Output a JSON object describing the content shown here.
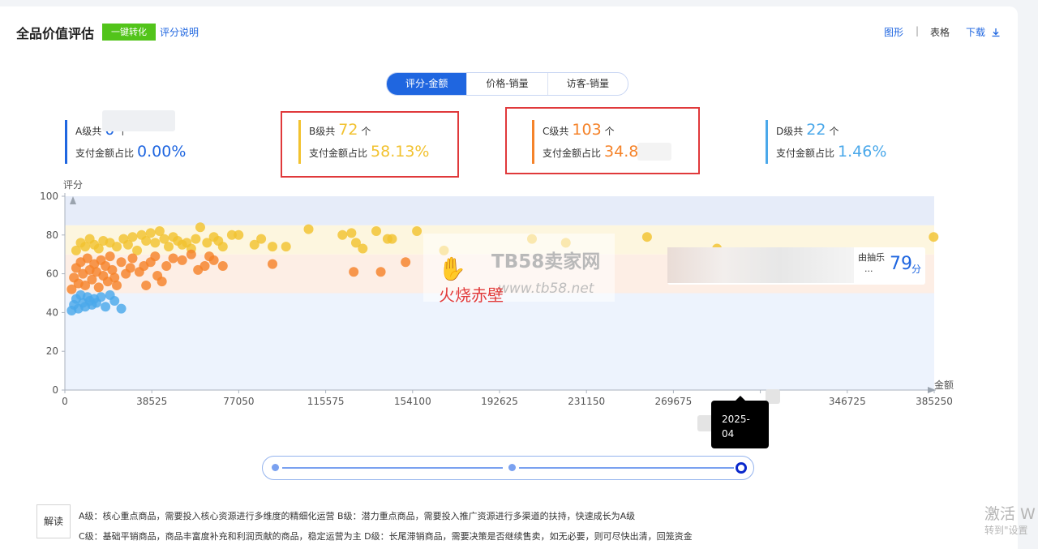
{
  "header": {
    "title": "全品价值评估",
    "convert_button": "一键转化",
    "score_link": "评分说明",
    "graph_link": "图形",
    "separator": "|",
    "table_link": "表格",
    "download_link": "下载"
  },
  "tabs": [
    {
      "label": "评分-金额",
      "active": true
    },
    {
      "label": "价格-销量",
      "active": false
    },
    {
      "label": "访客-销量",
      "active": false
    }
  ],
  "grades": [
    {
      "label": "A级共",
      "count": "0",
      "unit": "个",
      "ratio_label": "支付金额占比",
      "ratio": "0.00%",
      "color": "#1f66e0"
    },
    {
      "label": "B级共",
      "count": "72",
      "unit": "个",
      "ratio_label": "支付金额占比",
      "ratio": "58.13%",
      "color": "#f2c230"
    },
    {
      "label": "C级共",
      "count": "103",
      "unit": "个",
      "ratio_label": "支付金额占比",
      "ratio": "34.86%",
      "color": "#f5832a"
    },
    {
      "label": "D级共",
      "count": "22",
      "unit": "个",
      "ratio_label": "支付金额占比",
      "ratio": "1.46%",
      "color": "#4aa8ea"
    }
  ],
  "tooltip": {
    "name": "由抽乐",
    "ellipsis": "...",
    "score": "79",
    "unit": "分"
  },
  "watermark": {
    "logo": "✋",
    "line1": "TB58卖家网",
    "line2": "www.tb58.net",
    "red": "火烧赤壁"
  },
  "timeline": {
    "date": "2025-04"
  },
  "interpretation": {
    "button": "解读",
    "line1": "A级：核心重点商品，需要投入核心资源进行多维度的精细化运营   B级：潜力重点商品，需要投入推广资源进行多渠道的扶持，快速成长为A级",
    "line2": "C级：基础平销商品，商品丰富度补充和利润贡献的商品，稳定运营为主   D级：长尾滞销商品，需要决策是否继续售卖，如无必要，则可尽快出清，回笼资金"
  },
  "activation": {
    "line1": "激活 W",
    "line2": "转到\"设置"
  },
  "colors": {
    "A": "#1f66e0",
    "B": "#f2c230",
    "C": "#f5832a",
    "D": "#4aa8ea",
    "accent": "#1f66e0",
    "highlight": "#e0393b"
  },
  "chart_data": {
    "type": "scatter",
    "xlabel": "金额",
    "ylabel": "评分",
    "xlim": [
      0,
      385250
    ],
    "ylim": [
      0,
      100
    ],
    "x_ticks": [
      0,
      38525,
      77050,
      115575,
      154100,
      192625,
      231150,
      269675,
      308200,
      346725,
      385250
    ],
    "x_tick_labels": [
      "0",
      "38525",
      "77050",
      "115575",
      "154100",
      "192625",
      "231150",
      "269675",
      "",
      "346725",
      "385250"
    ],
    "y_ticks": [
      0,
      20,
      40,
      60,
      80,
      100
    ],
    "bands": [
      {
        "grade": "A",
        "from": 85,
        "to": 100,
        "color": "#e6ecf9"
      },
      {
        "grade": "B",
        "from": 70,
        "to": 85,
        "color": "#fdf6df"
      },
      {
        "grade": "C",
        "from": 50,
        "to": 70,
        "color": "#fdeee5"
      },
      {
        "grade": "D",
        "from": 0,
        "to": 50,
        "color": "#edf3fd"
      }
    ],
    "series": [
      {
        "grade": "B",
        "color": "#f2c230",
        "points": [
          [
            5000,
            72
          ],
          [
            7000,
            76
          ],
          [
            9000,
            74
          ],
          [
            11000,
            78
          ],
          [
            13000,
            75
          ],
          [
            15000,
            73
          ],
          [
            17000,
            77
          ],
          [
            20000,
            76
          ],
          [
            23000,
            74
          ],
          [
            26000,
            78
          ],
          [
            28000,
            75
          ],
          [
            30000,
            79
          ],
          [
            32000,
            72
          ],
          [
            34000,
            80
          ],
          [
            36000,
            77
          ],
          [
            38000,
            81
          ],
          [
            40000,
            76
          ],
          [
            42000,
            82
          ],
          [
            44000,
            78
          ],
          [
            46000,
            74
          ],
          [
            48000,
            79
          ],
          [
            50000,
            77
          ],
          [
            52000,
            75
          ],
          [
            54000,
            76
          ],
          [
            56000,
            73
          ],
          [
            58000,
            78
          ],
          [
            60000,
            84
          ],
          [
            63000,
            76
          ],
          [
            66000,
            79
          ],
          [
            68000,
            77
          ],
          [
            70000,
            74
          ],
          [
            74000,
            80
          ],
          [
            77000,
            80
          ],
          [
            84000,
            75
          ],
          [
            87000,
            78
          ],
          [
            92000,
            74
          ],
          [
            98000,
            74
          ],
          [
            108000,
            83
          ],
          [
            123000,
            80
          ],
          [
            127000,
            81
          ],
          [
            129000,
            76
          ],
          [
            132000,
            73
          ],
          [
            138000,
            82
          ],
          [
            143000,
            78
          ],
          [
            145000,
            78
          ],
          [
            156000,
            82
          ],
          [
            168000,
            72
          ],
          [
            207000,
            78
          ],
          [
            222000,
            76
          ],
          [
            258000,
            79
          ],
          [
            289000,
            73
          ],
          [
            385000,
            79
          ]
        ]
      },
      {
        "grade": "C",
        "color": "#f5832a",
        "points": [
          [
            3000,
            52
          ],
          [
            4000,
            58
          ],
          [
            5000,
            63
          ],
          [
            6000,
            55
          ],
          [
            7000,
            66
          ],
          [
            8000,
            60
          ],
          [
            9000,
            54
          ],
          [
            10000,
            68
          ],
          [
            11000,
            62
          ],
          [
            12000,
            57
          ],
          [
            13000,
            65
          ],
          [
            14000,
            61
          ],
          [
            15000,
            53
          ],
          [
            16000,
            67
          ],
          [
            17000,
            59
          ],
          [
            18000,
            64
          ],
          [
            19000,
            56
          ],
          [
            20000,
            69
          ],
          [
            21000,
            62
          ],
          [
            22000,
            58
          ],
          [
            23000,
            54
          ],
          [
            25000,
            66
          ],
          [
            27000,
            60
          ],
          [
            29000,
            63
          ],
          [
            30000,
            68
          ],
          [
            33000,
            61
          ],
          [
            35000,
            64
          ],
          [
            36000,
            54
          ],
          [
            38000,
            66
          ],
          [
            40000,
            69
          ],
          [
            41000,
            59
          ],
          [
            43000,
            56
          ],
          [
            45000,
            64
          ],
          [
            48000,
            68
          ],
          [
            52000,
            67
          ],
          [
            56000,
            70
          ],
          [
            59000,
            62
          ],
          [
            62000,
            64
          ],
          [
            64000,
            69
          ],
          [
            66000,
            67
          ],
          [
            70000,
            64
          ],
          [
            92000,
            65
          ],
          [
            128000,
            61
          ],
          [
            140000,
            61
          ],
          [
            151000,
            66
          ]
        ]
      },
      {
        "grade": "D",
        "color": "#4aa8ea",
        "points": [
          [
            3000,
            41
          ],
          [
            4000,
            44
          ],
          [
            5000,
            47
          ],
          [
            6000,
            42
          ],
          [
            7000,
            49
          ],
          [
            8000,
            45
          ],
          [
            9000,
            43
          ],
          [
            10000,
            48
          ],
          [
            11000,
            46
          ],
          [
            12000,
            44
          ],
          [
            13000,
            47
          ],
          [
            14000,
            45
          ],
          [
            16000,
            48
          ],
          [
            18000,
            43
          ],
          [
            20000,
            49
          ],
          [
            22000,
            46
          ],
          [
            25000,
            42
          ]
        ]
      }
    ]
  }
}
